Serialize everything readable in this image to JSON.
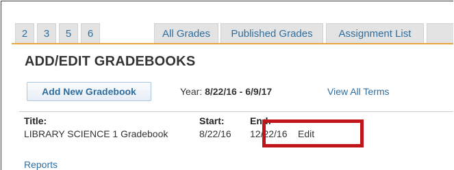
{
  "tabs": [
    {
      "label": "2"
    },
    {
      "label": "3"
    },
    {
      "label": "5"
    },
    {
      "label": "6"
    },
    {
      "label": "All Grades"
    },
    {
      "label": "Published Grades"
    },
    {
      "label": "Assignment List"
    }
  ],
  "page_title": "ADD/EDIT GRADEBOOKS",
  "toolbar": {
    "add_button": "Add New Gradebook",
    "year_label": "Year:",
    "year_value": "8/22/16 - 6/9/17",
    "view_all_terms": "View All Terms"
  },
  "gradebook": {
    "title_header": "Title:",
    "start_header": "Start:",
    "end_header": "End:",
    "title": "LIBRARY SCIENCE 1 Gradebook",
    "start": "8/22/16",
    "end": "12/22/16",
    "edit_label": "Edit"
  },
  "reports_link": "Reports",
  "colors": {
    "link": "#2f6d9e",
    "tab_background": "#e3e3e3",
    "tab_underline": "#e8a33b",
    "highlight_box": "#c0161b"
  }
}
